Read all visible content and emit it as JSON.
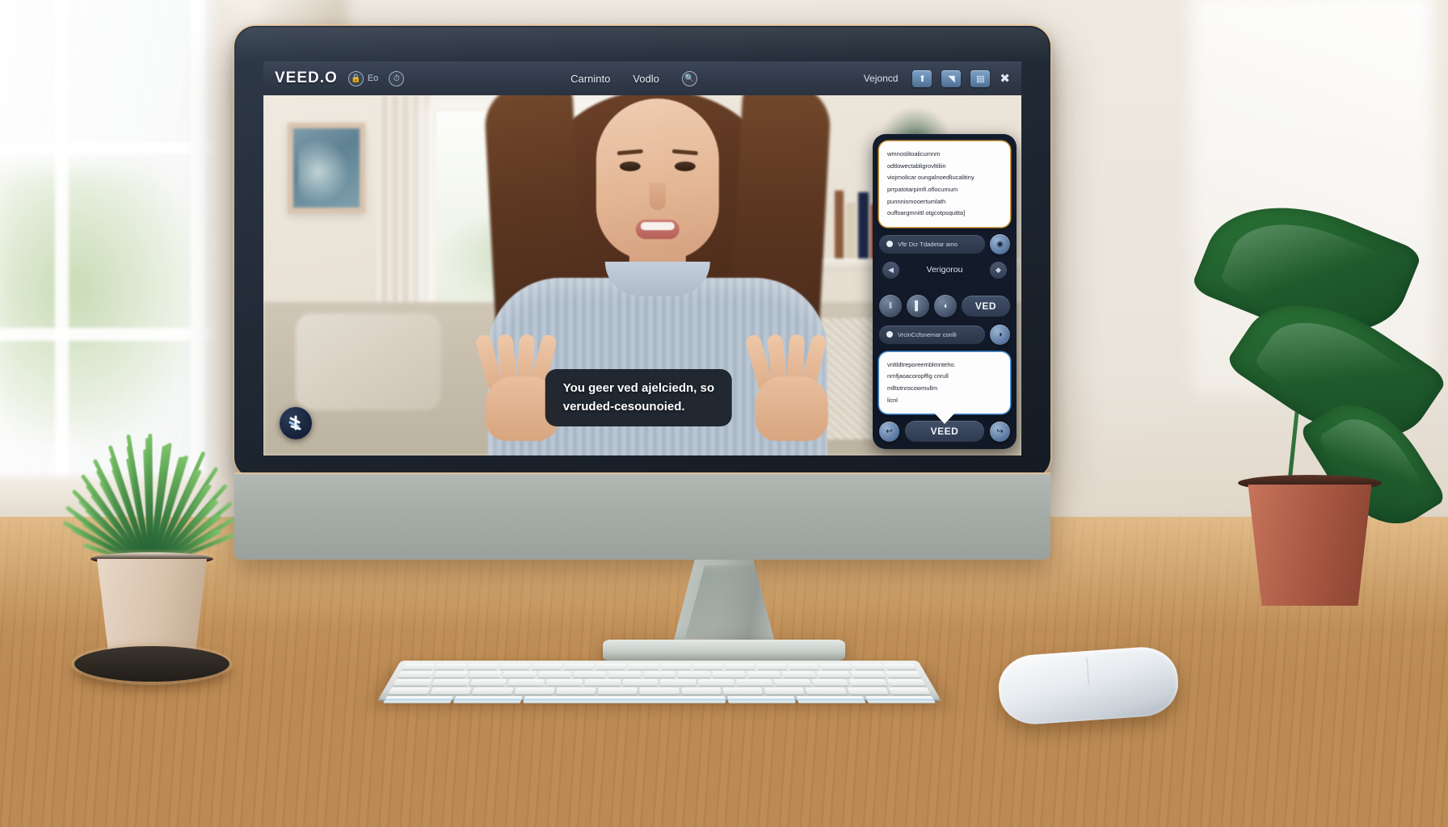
{
  "scene": {
    "title": "VEED.O video editor open on an all-in-one desktop computer in a sunlit home office",
    "setting_label": "home office desk with wooden top",
    "colors": {
      "brand_navy": "#16213a",
      "toolbar": "#333c4c",
      "panel_dark": "#141d2e",
      "accent_blue": "#5aaaff",
      "accent_amber": "#e8aa46",
      "desk_wood": "#bc8a53",
      "monitor_chin": "#a7aeaa"
    }
  },
  "toolbar": {
    "logo": "VEED.O",
    "lock_chip_label": "Eo",
    "lock_icon": "lock-icon",
    "clock_icon": "clock-icon",
    "menu_items": [
      {
        "label": "Carninto",
        "name": "menu-carninto"
      },
      {
        "label": "Vodlo",
        "name": "menu-vodlo"
      }
    ],
    "search_icon": "search-icon",
    "user_label": "Vejoncd",
    "buttons": [
      {
        "name": "export-button",
        "glyph": "⬆"
      },
      {
        "name": "share-button",
        "glyph": "◥"
      },
      {
        "name": "panel-button",
        "glyph": "▤"
      }
    ],
    "close_icon": "close-icon",
    "close_glyph": "✖"
  },
  "video": {
    "room": {
      "framed_art_label": "framed botanical artwork",
      "curtain_label": "white curtain",
      "window_label": "bright window with greenery outside",
      "shelf_label": "bookshelf with books and plant",
      "couch_label": "sofa with cushions"
    },
    "person": {
      "label": "woman with long brown hair in a light blue knit sweater, hands raised mid-gesture"
    },
    "books": [
      "#b8693f",
      "#e6e0d2",
      "#8a5a3c",
      "#d8cdb8",
      "#1d2a4a",
      "#c7492f",
      "#a8472c",
      "#d9d2c2",
      "#2a3557",
      "#b5452c",
      "#e0d8c6",
      "#8f3f2a",
      "#cfc6b2"
    ],
    "caption": {
      "line1": "You geer ved ajelciedn, so",
      "line2": "veruded-cesounoied."
    },
    "brand_badge": "veed-logo-badge"
  },
  "panel": {
    "note_top": {
      "name": "transcript-note-card",
      "lines": [
        "wmnoslitoalicumnm",
        "odtlowectabligrovltiliin",
        "viojrnolicar oungalnoedliucalitiny",
        "prrpatotarpimfi.oflocumum",
        "punnnismooertumlath",
        "ouffoargmnittl otgcotpsquitta]"
      ]
    },
    "row_top": {
      "pill_label": "Vftr Dcr Tdadetar amo",
      "pill_name": "subtitle-style-pill",
      "button_name": "record-button",
      "button_glyph": "◉"
    },
    "nav": {
      "prev_name": "prev-arrow-button",
      "prev_glyph": "◀",
      "label": "Verigorou",
      "next_name": "next-color-button",
      "next_glyph": "◆"
    },
    "tools": [
      {
        "name": "columns-tool",
        "glyph": "‖"
      },
      {
        "name": "text-cursor-tool",
        "glyph": "▌"
      },
      {
        "name": "eyedropper-tool",
        "glyph": "◖"
      }
    ],
    "ved_button": {
      "name": "ved-apply-button",
      "label": "VED"
    },
    "row_second": {
      "pill_label": "VrcinCcfsnernar conlli",
      "pill_name": "voice-option-pill",
      "button_name": "voice-toggle-button",
      "button_glyph": "◑"
    },
    "note_bottom": {
      "name": "tooltip-note-card",
      "lines": [
        "vnltldtreporeemblmnteho.",
        "nrnfjaoacoropffig cnrull",
        "mlltotnrocowmullm",
        "licnl"
      ]
    },
    "bottom_buttons": [
      {
        "name": "undo-button",
        "glyph": "↩"
      },
      {
        "name": "veed-action-button",
        "label": "VEED"
      },
      {
        "name": "redo-button",
        "glyph": "↪"
      }
    ]
  },
  "desk": {
    "keyboard_label": "white wireless keyboard",
    "mouse_label": "white wireless mouse",
    "plant_left_label": "grassy green plant in a beige ceramic pot on a dark coaster",
    "plant_right_label": "large tropical leaf plant in a terracotta pot"
  }
}
